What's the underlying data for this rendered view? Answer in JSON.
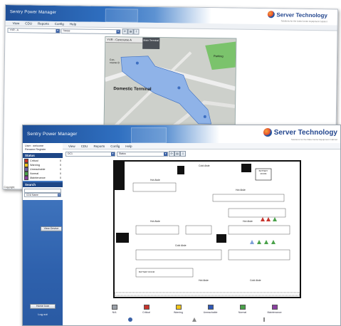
{
  "back_window": {
    "app_title": "Sentry Power Manager",
    "brand": "Server Technology",
    "tagline": "Solutions for the Data Center Equipment Cabinet",
    "menu": [
      "View",
      "CDU",
      "Reports",
      "Config",
      "Help"
    ],
    "location_select": "YVR - A",
    "status_select": "Status",
    "map": {
      "header": "YVR - Concourse A",
      "badge": "Main Terminal",
      "labels": [
        "Domestic Terminal",
        "Parking",
        "Con-course B"
      ]
    },
    "footer_text": "Copyright"
  },
  "front_window": {
    "app_title": "Sentry Power Manager",
    "brand": "Server Technology",
    "tagline": "Solutions for the Data Center Equipment Cabinet",
    "menu": [
      "View",
      "CDU",
      "Reports",
      "Config",
      "Help"
    ],
    "user_line": "User : welcome",
    "user_links": "Rename  Register",
    "location_select": "DC1",
    "status_select": "Status",
    "sidebar": {
      "status_header": "Status",
      "status_items": [
        {
          "label": "Critical",
          "count": "0",
          "color": "#c8342b"
        },
        {
          "label": "Warning",
          "count": "0",
          "color": "#f0c419"
        },
        {
          "label": "Unreachable",
          "count": "0",
          "color": "#6c5fa7"
        },
        {
          "label": "Normal",
          "count": "0",
          "color": "#4aa24a"
        },
        {
          "label": "Maintenance",
          "count": "0",
          "color": "#8a3fa0"
        }
      ],
      "search_header": "Search",
      "search_select": "CDU Name",
      "view_button": "View Device",
      "home_button": "Home Icon",
      "logout": "Log out"
    },
    "floorplan": {
      "labels": {
        "cold_aisle_top": "Cold Aisle",
        "hot_aisle_a": "Hot Aisle",
        "hot_aisle_b": "Hot Aisle",
        "hot_aisle_c": "Hot Aisle",
        "hot_aisle_d": "Hot Aisle",
        "cold_aisle_mid": "Cold Aisle",
        "hot_aisle_bottom": "Hot Aisle",
        "cold_aisle_bottom": "Cold Aisle",
        "battery_room": "BATTERY ROOM",
        "battery_room_2": "BATTERY ROOM"
      }
    },
    "legend": [
      {
        "label": "N/A",
        "color": "#9aa0a8"
      },
      {
        "label": "Critical",
        "color": "#c8342b"
      },
      {
        "label": "Warning",
        "color": "#f0c419"
      },
      {
        "label": "Unreachable",
        "color": "#2f58b7"
      },
      {
        "label": "Normal",
        "color": "#4aa24a"
      },
      {
        "label": "Maintenance",
        "color": "#8a3fa0"
      }
    ]
  }
}
